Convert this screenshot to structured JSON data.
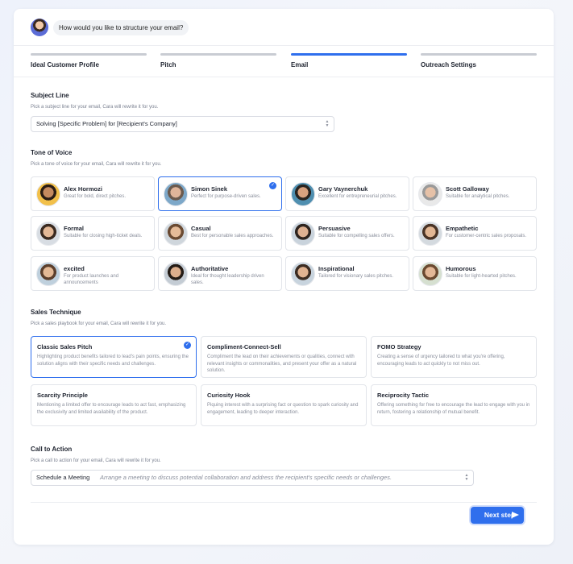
{
  "header": {
    "prompt": "How would you like to structure your email?"
  },
  "steps": [
    {
      "label": "Ideal Customer Profile"
    },
    {
      "label": "Pitch"
    },
    {
      "label": "Email"
    },
    {
      "label": "Outreach Settings"
    }
  ],
  "subject": {
    "title": "Subject Line",
    "help": "Pick a subject line for your email, Cara will rewrite it for you.",
    "value": "Solving [Specific Problem] for [Recipient's Company]"
  },
  "tone": {
    "title": "Tone of Voice",
    "help": "Pick a tone of voice for your email, Cara will rewrite it for you.",
    "items": [
      {
        "name": "Alex Hormozi",
        "desc": "Great for bold, direct pitches.",
        "skin": "#c58a5f",
        "hair": "#2b1d15",
        "bg": "#f2c04a"
      },
      {
        "name": "Simon Sinek",
        "desc": "Perfect for purpose-driven sales.",
        "skin": "#e0b59a",
        "hair": "#6b5a4e",
        "bg": "#7da8c9"
      },
      {
        "name": "Gary Vaynerchuk",
        "desc": "Excellent for entrepreneurial pitches.",
        "skin": "#d9a27f",
        "hair": "#2a2420",
        "bg": "#4f8fb0"
      },
      {
        "name": "Scott Galloway",
        "desc": "Suitable for analytical pitches.",
        "skin": "#e6c1a7",
        "hair": "#9a9a9a",
        "bg": "#e9e9e9"
      },
      {
        "name": "Formal",
        "desc": "Suitable for closing high-ticket deals.",
        "skin": "#e3b896",
        "hair": "#3a2a20",
        "bg": "#d8dde3"
      },
      {
        "name": "Casual",
        "desc": "Best for personable sales approaches.",
        "skin": "#e5bb98",
        "hair": "#6a4a32",
        "bg": "#cfd6dc"
      },
      {
        "name": "Persuasive",
        "desc": "Suitable for compelling sales offers.",
        "skin": "#deb191",
        "hair": "#2e241e",
        "bg": "#c9d3dc"
      },
      {
        "name": "Empathetic",
        "desc": "For customer-centric sales proposals.",
        "skin": "#e2b794",
        "hair": "#4a3426",
        "bg": "#d4dadf"
      },
      {
        "name": "excited",
        "desc": "For product launches and announcements",
        "skin": "#e4b995",
        "hair": "#5c3f2c",
        "bg": "#bfd0dd"
      },
      {
        "name": "Authoritative",
        "desc": "Ideal for thought leadership driven sales.",
        "skin": "#dcae8c",
        "hair": "#241b15",
        "bg": "#c4ccd4"
      },
      {
        "name": "Inspirational",
        "desc": "Tailored for visionary sales pitches.",
        "skin": "#e0b391",
        "hair": "#3c2c22",
        "bg": "#c8d4de"
      },
      {
        "name": "Humorous",
        "desc": "Suitable for light-hearted pitches.",
        "skin": "#e3b896",
        "hair": "#6b4a30",
        "bg": "#d6e0d0"
      }
    ]
  },
  "technique": {
    "title": "Sales Technique",
    "help": "Pick a sales playbook for your email, Cara will rewrite it for you.",
    "items": [
      {
        "name": "Classic Sales Pitch",
        "desc": "Highlighting product benefits tailored to lead's pain points, ensuring the solution aligns with their specific needs and challenges."
      },
      {
        "name": "Compliment-Connect-Sell",
        "desc": "Compliment the lead on their achievements or qualities, connect with relevant insights or commonalities, and present your offer as a natural solution."
      },
      {
        "name": "FOMO Strategy",
        "desc": "Creating a sense of urgency tailored to what you're offering, encouraging leads to act quickly to not miss out."
      },
      {
        "name": "Scarcity Principle",
        "desc": "Mentioning a limited offer to encourage leads to act fast, emphasizing the exclusivity and limited availability of the product."
      },
      {
        "name": "Curiosity Hook",
        "desc": "Piquing interest with a surprising fact or question to spark curiosity and engagement, leading to deeper interaction."
      },
      {
        "name": "Reciprocity Tactic",
        "desc": "Offering something for free to encourage the lead to engage with you in return, fostering a relationship of mutual benefit."
      }
    ]
  },
  "cta": {
    "title": "Call to Action",
    "help": "Pick a call to action for your email, Cara will rewrite it for you.",
    "value": "Schedule a Meeting",
    "desc": "Arrange a meeting to discuss potential collaboration and address the recipient's specific needs or challenges."
  },
  "footer": {
    "next_label": "Next step"
  },
  "colors": {
    "accent": "#2f6fed"
  },
  "icons": {
    "check": "check-circle-icon",
    "select": "chevron-updown-icon",
    "send": "send-icon"
  },
  "selection": {
    "tone_index": 1,
    "technique_index": 0,
    "active_step": 2
  }
}
